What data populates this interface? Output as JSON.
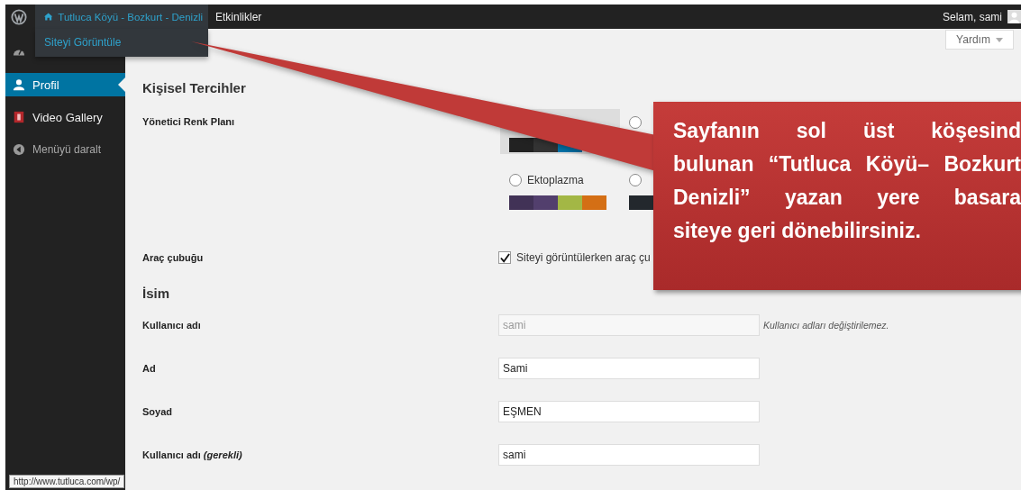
{
  "admin_bar": {
    "site_name": "Tutluca Köyü - Bozkurt - Denizli",
    "items": [
      {
        "label": "Etkinlikler"
      }
    ],
    "greeting": "Selam, sami",
    "dropdown": [
      {
        "label": "Siteyi Görüntüle"
      }
    ]
  },
  "sidebar": {
    "items": [
      {
        "kind": "dashboard",
        "selected": false
      },
      {
        "kind": "user",
        "label": "Profil",
        "selected": true
      },
      {
        "kind": "video",
        "label": "Video Gallery",
        "selected": false
      },
      {
        "kind": "collapse",
        "label": "Menüyü daralt",
        "selected": false
      }
    ]
  },
  "help_button": {
    "label": "Yardım"
  },
  "sections": [
    {
      "heading": "Kişisel Tercihler",
      "rows": [
        {
          "kind": "color_schemes",
          "label": "Yönetici Renk Planı",
          "schemes": [
            {
              "selected": true,
              "colors": [
                {
                  "color": "#222222"
                },
                {
                  "color": "#333333"
                },
                {
                  "color": "#0073aa"
                }
              ]
            },
            {
              "selected": false
            },
            {
              "selected": false,
              "name": "Ektoplazma",
              "colors": [
                {
                  "color": "#413256"
                },
                {
                  "color": "#523f6d"
                },
                {
                  "color": "#a3b745"
                },
                {
                  "color": "#d46f15"
                }
              ]
            },
            {
              "selected": false,
              "colors": [
                {
                  "color": "#23282d"
                }
              ]
            }
          ]
        },
        {
          "kind": "checkbox",
          "label": "Araç çubuğu",
          "checked": true,
          "text": "Siteyi görüntülerken araç çu"
        }
      ]
    },
    {
      "heading": "İsim",
      "rows": [
        {
          "kind": "text_field",
          "label": "Kullanıcı adı",
          "value": "sami",
          "disabled": true,
          "description": "Kullanıcı adları değiştirilemez."
        },
        {
          "kind": "text_field",
          "label": "Ad",
          "value": "Sami",
          "disabled": false
        },
        {
          "kind": "text_field",
          "label": "Soyad",
          "value": "EŞMEN",
          "disabled": false
        },
        {
          "kind": "text_field",
          "label": "Kullanıcı adı *(gerekli)*",
          "value": "sami",
          "disabled": false
        }
      ]
    }
  ],
  "callout": {
    "lines": [
      "Sayfanın sol üst köşesind",
      "bulunan “Tutluca Köyü– Bozkurt",
      "Denizli” yazan yere basara",
      "siteye geri dönebilirsiniz."
    ]
  },
  "status_tooltip": "http://www.tutluca.com/wp/"
}
